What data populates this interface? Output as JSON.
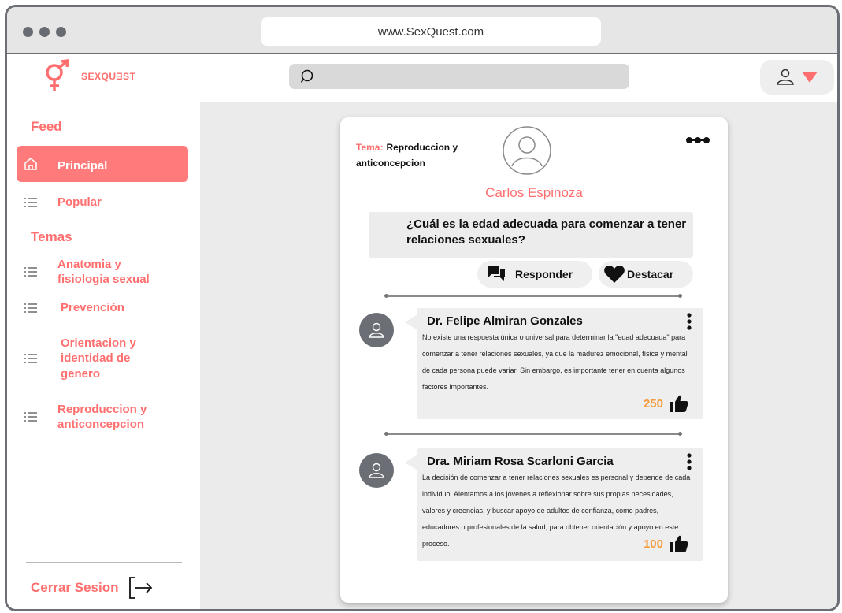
{
  "browser": {
    "url": "www.SexQuest.com"
  },
  "app": {
    "logo_text": "SEXQUƎST"
  },
  "colors": {
    "accent": "#ff6f6f",
    "likes": "#f59b3a",
    "avatar": "#6b6f75"
  },
  "sidebar": {
    "feed_title": "Feed",
    "feed_items": [
      {
        "label": "Principal",
        "icon": "home-icon",
        "active": true
      },
      {
        "label": "Popular",
        "icon": "list-icon",
        "active": false
      }
    ],
    "temas_title": "Temas",
    "temas_items": [
      {
        "label": "Anatomia y fisiologia sexual",
        "icon": "list-icon"
      },
      {
        "label": "Prevención",
        "icon": "list-icon"
      },
      {
        "label": "Orientacion y identidad de genero",
        "icon": "list-icon"
      },
      {
        "label": "Reproduccion y anticoncepcion",
        "icon": "list-icon"
      }
    ],
    "logout_label": "Cerrar Sesion"
  },
  "post": {
    "tema_label": "Tema:",
    "tema_value": "Reproduccion y anticoncepcion",
    "author": "Carlos Espinoza",
    "question": "¿Cuál es la edad adecuada para comenzar a tener relaciones sexuales?",
    "reply_label": "Responder",
    "highlight_label": "Destacar",
    "answers": [
      {
        "name": "Dr. Felipe Almiran Gonzales",
        "text": "No existe una respuesta única o universal para determinar la \"edad adecuada\" para comenzar a tener relaciones sexuales, ya que la madurez emocional, física y mental de cada persona puede variar. Sin embargo, es importante tener en cuenta algunos factores importantes.",
        "likes": "250"
      },
      {
        "name": "Dra. Miriam Rosa Scarloni Garcia",
        "text": "La decisión de comenzar a tener relaciones sexuales es personal y depende de cada individuo. Alentamos a los jóvenes a reflexionar sobre sus propias necesidades, valores y creencias, y buscar apoyo de adultos de confianza, como padres, educadores o profesionales de la salud, para obtener orientación y apoyo en este proceso.",
        "likes": "100"
      }
    ]
  }
}
